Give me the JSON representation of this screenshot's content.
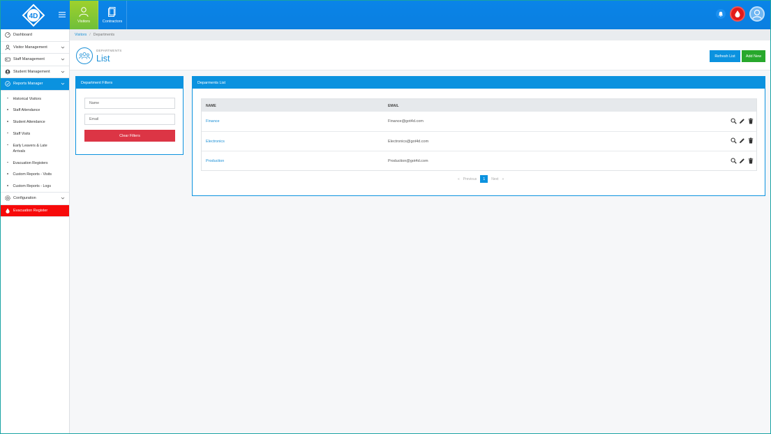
{
  "topnav": {
    "items": [
      {
        "label": "Visitors",
        "icon": "visitor-icon",
        "active": true
      },
      {
        "label": "Contractors",
        "icon": "contractor-icon",
        "active": false
      }
    ]
  },
  "sidebar": {
    "items": [
      {
        "label": "Dashboard",
        "icon": "dashboard-icon"
      },
      {
        "label": "Visitor Management",
        "icon": "visitor-management-icon"
      },
      {
        "label": "Staff Management",
        "icon": "staff-management-icon"
      },
      {
        "label": "Student Management",
        "icon": "student-management-icon"
      },
      {
        "label": "Reports Manager",
        "icon": "reports-icon"
      },
      {
        "label": "Configuration",
        "icon": "gear-icon"
      },
      {
        "label": "Evacuation Register",
        "icon": "evacuation-icon"
      }
    ],
    "reports_sub": [
      "Historical Visitors",
      "Staff Attendance",
      "Student Attendance",
      "Staff Visits",
      "Early Leavers & Late Arrivals",
      "Evacuation Registers",
      "Custom Reports - Visits",
      "Custom Reports - Logs"
    ]
  },
  "breadcrumb": {
    "root": "Visitors",
    "sep": "/",
    "current": "Departments"
  },
  "header": {
    "subtitle": "DEPARTMENTS",
    "title": "List",
    "refresh_label": "Refresh List",
    "add_label": "Add New"
  },
  "filters": {
    "title": "Department Filters",
    "name_placeholder": "Name",
    "email_placeholder": "Email",
    "clear_label": "Clear Filters"
  },
  "list": {
    "title": "Deparments List",
    "columns": {
      "name": "NAME",
      "email": "EMAIL"
    },
    "rows": [
      {
        "name": "Finance",
        "email": "Finance@got4d.com"
      },
      {
        "name": "Electronics",
        "email": "Electronics@got4d.com"
      },
      {
        "name": "Production",
        "email": "Production@got4d.com"
      }
    ]
  },
  "pager": {
    "prev": "Previous",
    "current": "1",
    "next": "Next",
    "prev_arrow": "«",
    "next_arrow": "»"
  },
  "colors": {
    "primary": "#0b92df",
    "success": "#27a82c",
    "danger": "#dc3545",
    "evac": "#f70a0a"
  }
}
